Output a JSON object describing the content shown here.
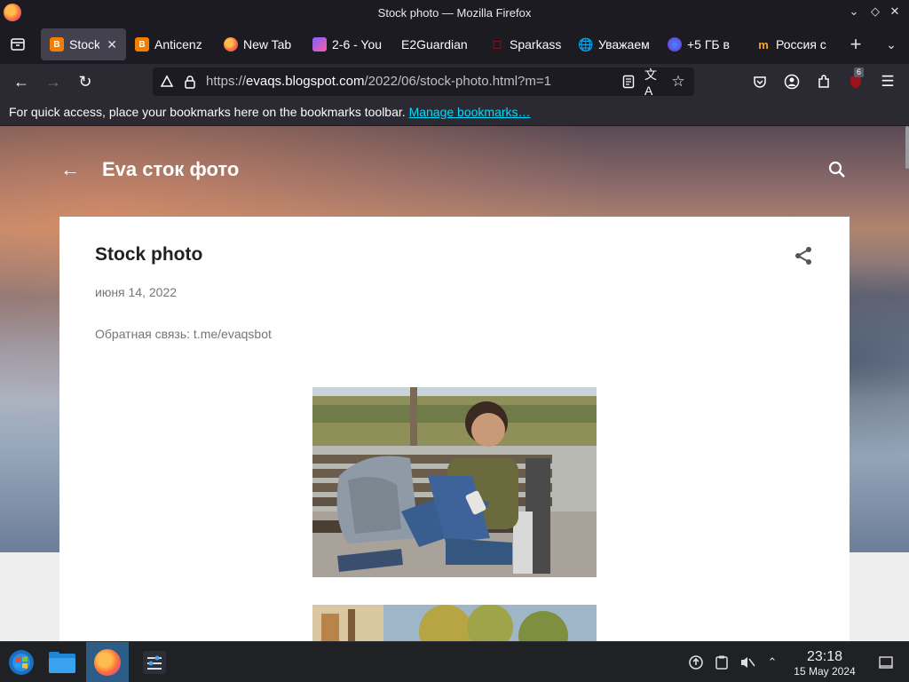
{
  "window": {
    "title": "Stock photo — Mozilla Firefox"
  },
  "tabs": [
    {
      "label": "Stock",
      "favicon": "blogger-icon",
      "color": "#f57d00",
      "active": true
    },
    {
      "label": "Anticenz",
      "favicon": "blogger-icon",
      "color": "#f57d00"
    },
    {
      "label": "New Tab",
      "favicon": "firefox-icon"
    },
    {
      "label": "2-6 - You",
      "favicon": "app-icon"
    },
    {
      "label": "E2Guardian",
      "favicon": "none"
    },
    {
      "label": "Sparkass",
      "favicon": "sparkasse-icon",
      "color": "#e30613"
    },
    {
      "label": "Уважаем",
      "favicon": "globe-icon"
    },
    {
      "label": "+5 ГБ в",
      "favicon": "app-icon"
    },
    {
      "label": "Россия с",
      "favicon": "m-icon"
    }
  ],
  "navbar": {
    "url_prefix": "https://",
    "url_host": "evaqs.blogspot.com",
    "url_path": "/2022/06/stock-photo.html?m=1",
    "extensions_badge": "6"
  },
  "bookmarks_bar": {
    "message": "For quick access, place your bookmarks here on the bookmarks toolbar.",
    "link": "Manage bookmarks…"
  },
  "blog": {
    "title": "Eva сток фото",
    "post": {
      "title": "Stock photo",
      "date": "июня 14, 2022",
      "feedback": "Обратная связь: t.me/evaqsbot"
    }
  },
  "taskbar": {
    "time": "23:18",
    "date": "15 May 2024"
  }
}
